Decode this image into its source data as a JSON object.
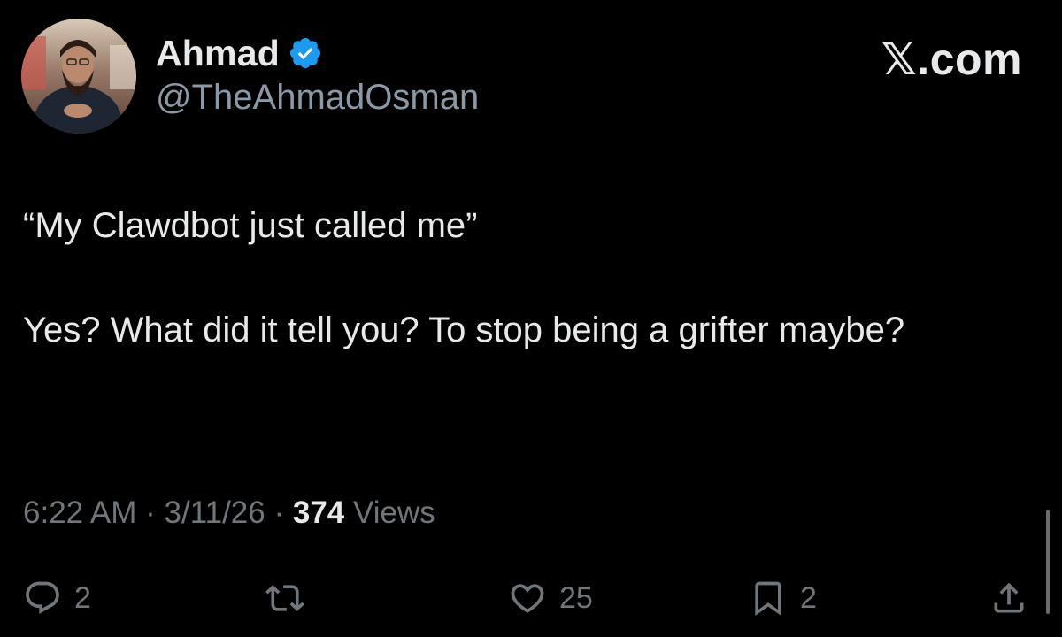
{
  "author": {
    "display_name": "Ahmad",
    "handle": "@TheAhmadOsman",
    "verified": true,
    "verified_icon": "verified-badge-icon",
    "verified_color": "#1d9bf0"
  },
  "brand": {
    "label": "𝕏.com"
  },
  "tweet": {
    "lines": [
      "“My Clawdbot just called me”",
      "Yes? What did it tell you? To stop being a grifter maybe?"
    ]
  },
  "meta": {
    "time": "6:22 AM",
    "separator": "·",
    "date": "3/11/26",
    "views_count": "374",
    "views_label": "Views"
  },
  "actions": {
    "reply": {
      "icon": "reply-icon",
      "count": "2"
    },
    "retweet": {
      "icon": "retweet-icon"
    },
    "like": {
      "icon": "heart-icon",
      "count": "25"
    },
    "bookmark": {
      "icon": "bookmark-icon",
      "count": "2"
    },
    "share": {
      "icon": "share-icon"
    }
  },
  "colors": {
    "background": "#000000",
    "primary_text": "#e7e9ea",
    "secondary_text": "#71767b",
    "accent": "#1d9bf0"
  }
}
